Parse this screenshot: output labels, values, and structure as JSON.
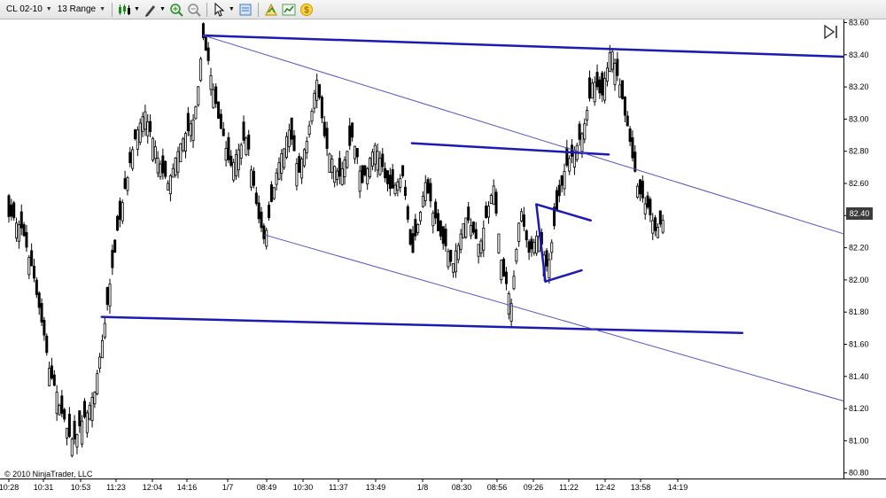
{
  "toolbar": {
    "instrument": "CL 02-10",
    "bar_type": "13 Range"
  },
  "copyright": "© 2010 NinjaTrader, LLC",
  "last_price": "82.40",
  "colors": {
    "trendline": "#1b1bb4",
    "channel": "#5353c8",
    "candle": "#000000",
    "badge": "#3c3c3c"
  },
  "chart_data": {
    "type": "candlestick",
    "title": "",
    "price_axis": {
      "ylim": [
        80.75,
        83.62
      ],
      "ticks": [
        "83.60",
        "83.40",
        "83.20",
        "83.00",
        "82.80",
        "82.60",
        "82.40",
        "82.20",
        "82.00",
        "81.80",
        "81.60",
        "81.40",
        "81.20",
        "81.00",
        "80.80"
      ]
    },
    "time_labels": [
      "10:28",
      "10:31",
      "10:53",
      "11:23",
      "12:04",
      "14:16",
      "1/7",
      "08:49",
      "10:30",
      "11:37",
      "13:49",
      "1/8",
      "08:30",
      "08:56",
      "09:26",
      "11:22",
      "12:42",
      "13:58",
      "14:19"
    ],
    "bar_count": 260,
    "close_path": [
      [
        0,
        82.4
      ],
      [
        5,
        82.35
      ],
      [
        10,
        82.1
      ],
      [
        18,
        81.45
      ],
      [
        25,
        81.1
      ],
      [
        28,
        81.0
      ],
      [
        34,
        81.15
      ],
      [
        38,
        81.3
      ],
      [
        42,
        81.7
      ],
      [
        48,
        82.3
      ],
      [
        55,
        82.85
      ],
      [
        60,
        83.05
      ],
      [
        66,
        82.75
      ],
      [
        70,
        82.6
      ],
      [
        76,
        82.85
      ],
      [
        82,
        83.0
      ],
      [
        86,
        83.52
      ],
      [
        92,
        83.05
      ],
      [
        98,
        82.7
      ],
      [
        105,
        82.9
      ],
      [
        110,
        82.4
      ],
      [
        113,
        82.25
      ],
      [
        118,
        82.65
      ],
      [
        124,
        82.95
      ],
      [
        128,
        82.65
      ],
      [
        132,
        82.9
      ],
      [
        136,
        83.25
      ],
      [
        140,
        82.85
      ],
      [
        146,
        82.65
      ],
      [
        152,
        82.9
      ],
      [
        156,
        82.6
      ],
      [
        162,
        82.85
      ],
      [
        168,
        82.55
      ],
      [
        174,
        82.65
      ],
      [
        178,
        82.15
      ],
      [
        184,
        82.6
      ],
      [
        190,
        82.3
      ],
      [
        196,
        82.1
      ],
      [
        202,
        82.4
      ],
      [
        208,
        82.2
      ],
      [
        214,
        82.6
      ],
      [
        218,
        82.05
      ],
      [
        222,
        81.85
      ],
      [
        226,
        82.45
      ],
      [
        230,
        82.15
      ],
      [
        234,
        82.3
      ],
      [
        238,
        82.05
      ],
      [
        242,
        82.45
      ],
      [
        246,
        82.7
      ],
      [
        250,
        82.8
      ],
      [
        254,
        82.95
      ],
      [
        258,
        83.25
      ],
      [
        262,
        83.15
      ],
      [
        266,
        83.45
      ],
      [
        270,
        83.2
      ],
      [
        274,
        82.9
      ],
      [
        278,
        82.55
      ],
      [
        282,
        82.45
      ],
      [
        286,
        82.3
      ],
      [
        290,
        82.4
      ]
    ],
    "trendlines": [
      {
        "name": "upper-resistance",
        "from": [
          83.52,
          86
        ],
        "to": [
          83.42,
          300
        ]
      },
      {
        "name": "support",
        "from": [
          81.77,
          41
        ],
        "to": [
          81.67,
          324
        ]
      },
      {
        "name": "mid-resistance",
        "from": [
          82.85,
          178
        ],
        "to": [
          82.78,
          265
        ]
      },
      {
        "name": "pennant-top",
        "from": [
          82.47,
          233
        ],
        "to": [
          82.37,
          257
        ]
      },
      {
        "name": "pennant-bottom",
        "from": [
          81.99,
          237
        ],
        "to": [
          82.06,
          253
        ]
      },
      {
        "name": "pennant-left",
        "from": [
          82.47,
          233
        ],
        "to": [
          81.99,
          237
        ]
      },
      {
        "name": "channel-upper",
        "from": [
          83.52,
          86
        ],
        "to": [
          82.29,
          368
        ]
      },
      {
        "name": "channel-lower",
        "from": [
          82.28,
          113
        ],
        "to": [
          81.25,
          368
        ]
      }
    ]
  }
}
